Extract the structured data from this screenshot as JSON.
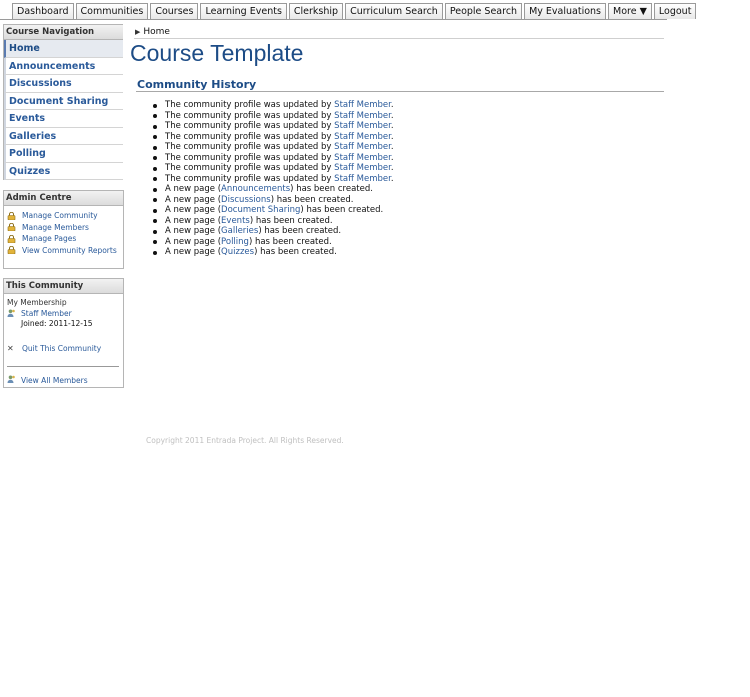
{
  "topnav": {
    "tabs": [
      "Dashboard",
      "Communities",
      "Courses",
      "Learning Events",
      "Clerkship",
      "Curriculum Search",
      "People Search",
      "My Evaluations",
      "More ▼",
      "Logout"
    ]
  },
  "course_nav": {
    "title": "Course Navigation",
    "items": [
      "Home",
      "Announcements",
      "Discussions",
      "Document Sharing",
      "Events",
      "Galleries",
      "Polling",
      "Quizzes"
    ]
  },
  "admin": {
    "title": "Admin Centre",
    "links": [
      "Manage Community",
      "Manage Members",
      "Manage Pages",
      "View Community Reports"
    ]
  },
  "community": {
    "title": "This Community",
    "membership_label": "My Membership",
    "member_name": "Staff Member",
    "joined": "Joined: 2011-12-15",
    "quit": "Quit This Community",
    "view_all": "View All Members"
  },
  "main": {
    "breadcrumb": "Home",
    "title": "Course Template",
    "section_title": "Community History",
    "history": [
      {
        "pre": "The community profile was updated by ",
        "link": "Staff Member",
        "post": "."
      },
      {
        "pre": "The community profile was updated by ",
        "link": "Staff Member",
        "post": "."
      },
      {
        "pre": "The community profile was updated by ",
        "link": "Staff Member",
        "post": "."
      },
      {
        "pre": "The community profile was updated by ",
        "link": "Staff Member",
        "post": "."
      },
      {
        "pre": "The community profile was updated by ",
        "link": "Staff Member",
        "post": "."
      },
      {
        "pre": "The community profile was updated by ",
        "link": "Staff Member",
        "post": "."
      },
      {
        "pre": "The community profile was updated by ",
        "link": "Staff Member",
        "post": "."
      },
      {
        "pre": "The community profile was updated by ",
        "link": "Staff Member",
        "post": "."
      },
      {
        "pre": "A new page (",
        "link": "Announcements",
        "post": ") has been created."
      },
      {
        "pre": "A new page (",
        "link": "Discussions",
        "post": ") has been created."
      },
      {
        "pre": "A new page (",
        "link": "Document Sharing",
        "post": ") has been created."
      },
      {
        "pre": "A new page (",
        "link": "Events",
        "post": ") has been created."
      },
      {
        "pre": "A new page (",
        "link": "Galleries",
        "post": ") has been created."
      },
      {
        "pre": "A new page (",
        "link": "Polling",
        "post": ") has been created."
      },
      {
        "pre": "A new page (",
        "link": "Quizzes",
        "post": ") has been created."
      }
    ]
  },
  "footer": {
    "copyright": "Copyright 2011 Entrada Project. All Rights Reserved."
  },
  "colors": {
    "link": "#2a5a9a",
    "title": "#1d4c86"
  }
}
